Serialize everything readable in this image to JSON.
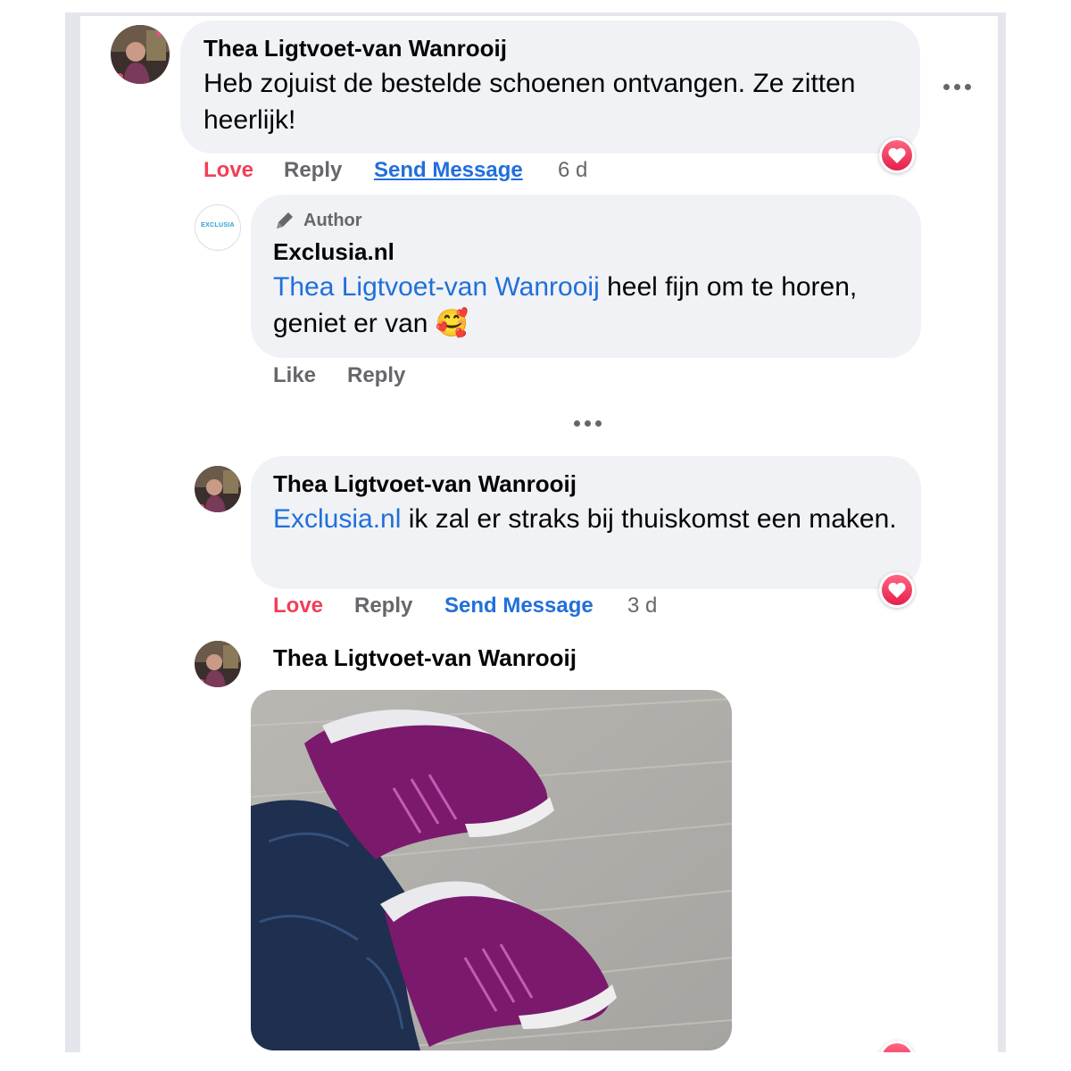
{
  "comment1": {
    "author": "Thea Ligtvoet-van Wanrooij",
    "text": "Heb zojuist de bestelde schoenen ontvangen. Ze zitten heerlijk!",
    "actions": {
      "love": "Love",
      "reply": "Reply",
      "send_message": "Send Message",
      "time": "6 d"
    },
    "reaction_icon": "heart-icon"
  },
  "reply1": {
    "badge": "Author",
    "badge_icon": "pen-icon",
    "avatar_text": "EXCLUSIA",
    "author": "Exclusia.nl",
    "mention": "Thea Ligtvoet-van Wanrooij",
    "text": " heel fijn om te horen, geniet er van ",
    "emoji": "🥰",
    "actions": {
      "like": "Like",
      "reply": "Reply"
    }
  },
  "reply2": {
    "author": "Thea Ligtvoet-van Wanrooij",
    "mention": "Exclusia.nl",
    "text": " ik zal er straks bij thuiskomst een maken.",
    "actions": {
      "love": "Love",
      "reply": "Reply",
      "send_message": "Send Message",
      "time": "3 d"
    },
    "reaction_icon": "heart-icon"
  },
  "reply3": {
    "author": "Thea Ligtvoet-van Wanrooij",
    "photo": "purple-sneakers-photo"
  },
  "colors": {
    "love": "#f33e58",
    "link": "#216fdb",
    "bubble": "#f0f2f5",
    "muted": "#65676b"
  }
}
